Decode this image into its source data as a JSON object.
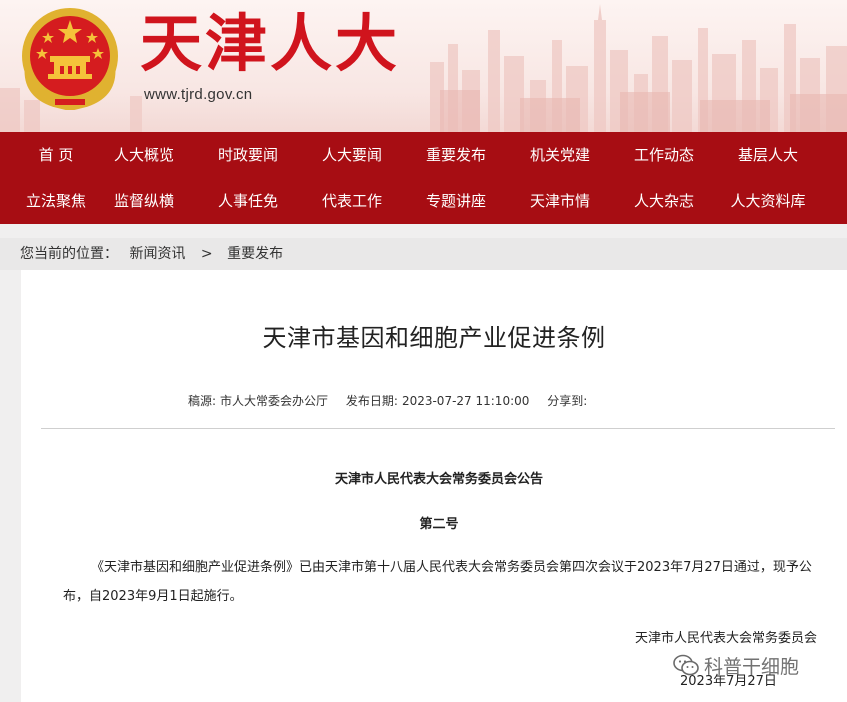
{
  "header": {
    "site_title": "天津人大",
    "site_url": "www.tjrd.gov.cn",
    "emblem_icon": "national-emblem-icon",
    "brand_color": "#d0141d"
  },
  "nav": {
    "color": "#a70d13",
    "row1": [
      "首 页",
      "人大概览",
      "时政要闻",
      "人大要闻",
      "重要发布",
      "机关党建",
      "工作动态",
      "基层人大"
    ],
    "row2": [
      "立法聚焦",
      "监督纵横",
      "人事任免",
      "代表工作",
      "专题讲座",
      "天津市情",
      "人大杂志",
      "人大资料库"
    ]
  },
  "breadcrumb": {
    "label": "您当前的位置：",
    "items": [
      "新闻资讯",
      "重要发布"
    ],
    "separator": ">"
  },
  "article": {
    "title": "天津市基因和细胞产业促进条例",
    "source_label": "稿源:",
    "source": "市人大常委会办公厅",
    "date_label": "发布日期:",
    "date": "2023-07-27 11:10:00",
    "share_label": "分享到:",
    "notice_title": "天津市人民代表大会常务委员会公告",
    "notice_no": "第二号",
    "body": "《天津市基因和细胞产业促进条例》已由天津市第十八届人民代表大会常务委员会第四次会议于2023年7月27日通过，现予公布，自2023年9月1日起施行。",
    "signer": "天津市人民代表大会常务委员会",
    "sign_date": "2023年7月27日"
  },
  "watermark": {
    "text": "科普干细胞",
    "icon": "wechat-icon"
  }
}
